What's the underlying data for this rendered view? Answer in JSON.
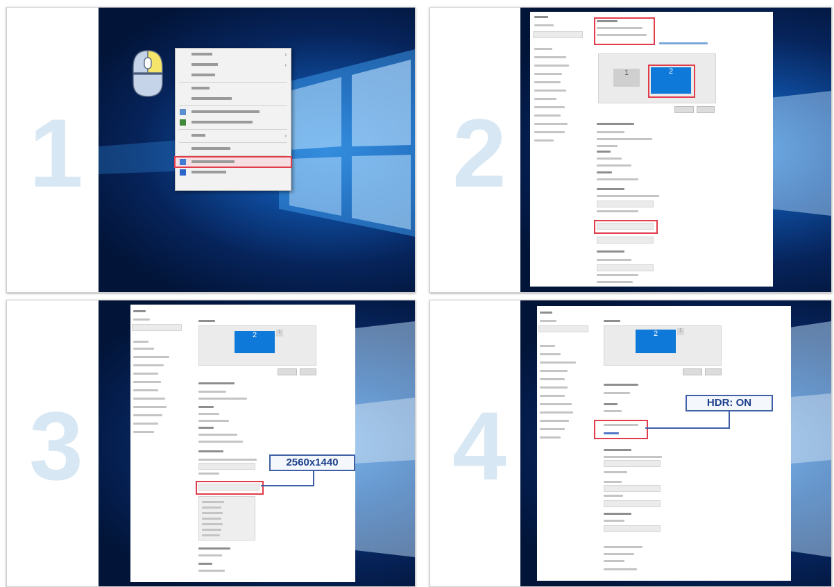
{
  "steps": [
    {
      "number": "1"
    },
    {
      "number": "2"
    },
    {
      "number": "3"
    },
    {
      "number": "4"
    }
  ],
  "step3": {
    "callout": "2560x1440"
  },
  "step4": {
    "callout": "HDR: ON"
  },
  "colors": {
    "accent": "#0e79d8",
    "highlight": "#e03c4a",
    "callout_border": "#3f5fa6",
    "step_number": "#d7e7f3"
  }
}
